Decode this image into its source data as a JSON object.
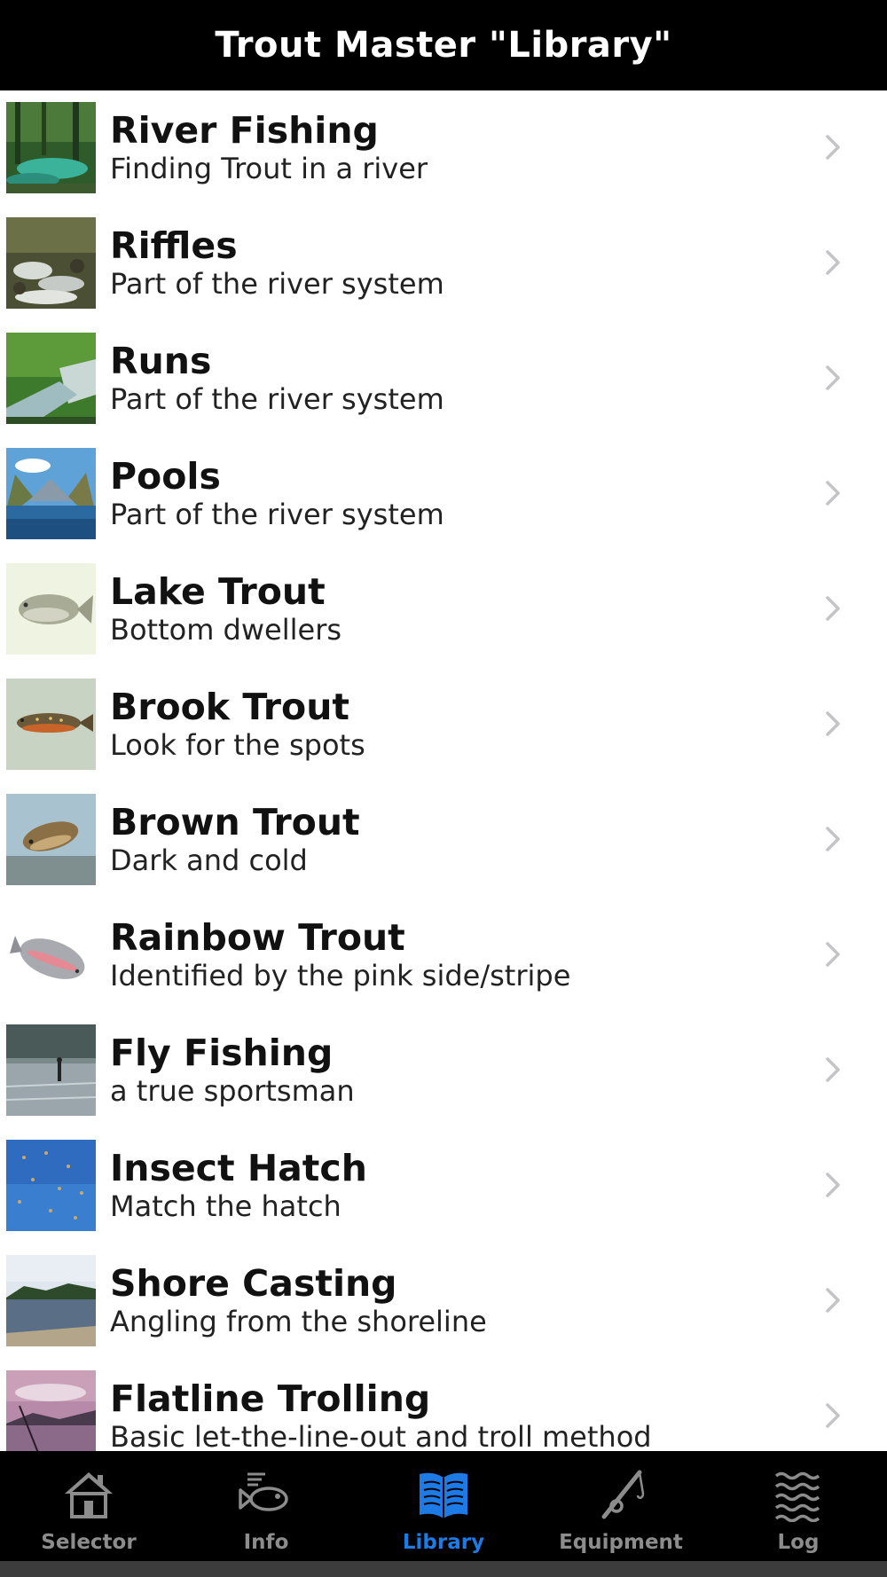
{
  "header": {
    "title": "Trout Master \"Library\""
  },
  "items": [
    {
      "title": "River Fishing",
      "subtitle": "Finding Trout in a river",
      "thumb": "river-forest-photo"
    },
    {
      "title": "Riffles",
      "subtitle": "Part of the river system",
      "thumb": "riffles-photo"
    },
    {
      "title": "Runs",
      "subtitle": "Part of the river system",
      "thumb": "runs-photo"
    },
    {
      "title": "Pools",
      "subtitle": "Part of the river system",
      "thumb": "pools-mountain-photo"
    },
    {
      "title": "Lake Trout",
      "subtitle": "Bottom dwellers",
      "thumb": "lake-trout-illustration"
    },
    {
      "title": "Brook Trout",
      "subtitle": "Look for the spots",
      "thumb": "brook-trout-illustration"
    },
    {
      "title": "Brown Trout",
      "subtitle": "Dark and cold",
      "thumb": "brown-trout-illustration"
    },
    {
      "title": "Rainbow Trout",
      "subtitle": "Identified by the pink side/stripe",
      "thumb": "rainbow-trout-illustration"
    },
    {
      "title": "Fly Fishing",
      "subtitle": "a true sportsman",
      "thumb": "fly-fishing-photo"
    },
    {
      "title": "Insect Hatch",
      "subtitle": "Match the hatch",
      "thumb": "insect-hatch-photo"
    },
    {
      "title": "Shore Casting",
      "subtitle": "Angling from the shoreline",
      "thumb": "shoreline-photo"
    },
    {
      "title": "Flatline Trolling",
      "subtitle": "Basic let-the-line-out and troll method",
      "thumb": "sunset-lake-photo"
    }
  ],
  "tabs": [
    {
      "label": "Selector",
      "icon": "house-icon",
      "active": false
    },
    {
      "label": "Info",
      "icon": "fish-icon",
      "active": false
    },
    {
      "label": "Library",
      "icon": "open-book-icon",
      "active": true
    },
    {
      "label": "Equipment",
      "icon": "fishing-rod-icon",
      "active": false
    },
    {
      "label": "Log",
      "icon": "waves-icon",
      "active": false
    }
  ],
  "colors": {
    "nav_background": "#000000",
    "active_tab": "#1e7be6",
    "inactive_tab": "#8c8c8c"
  }
}
